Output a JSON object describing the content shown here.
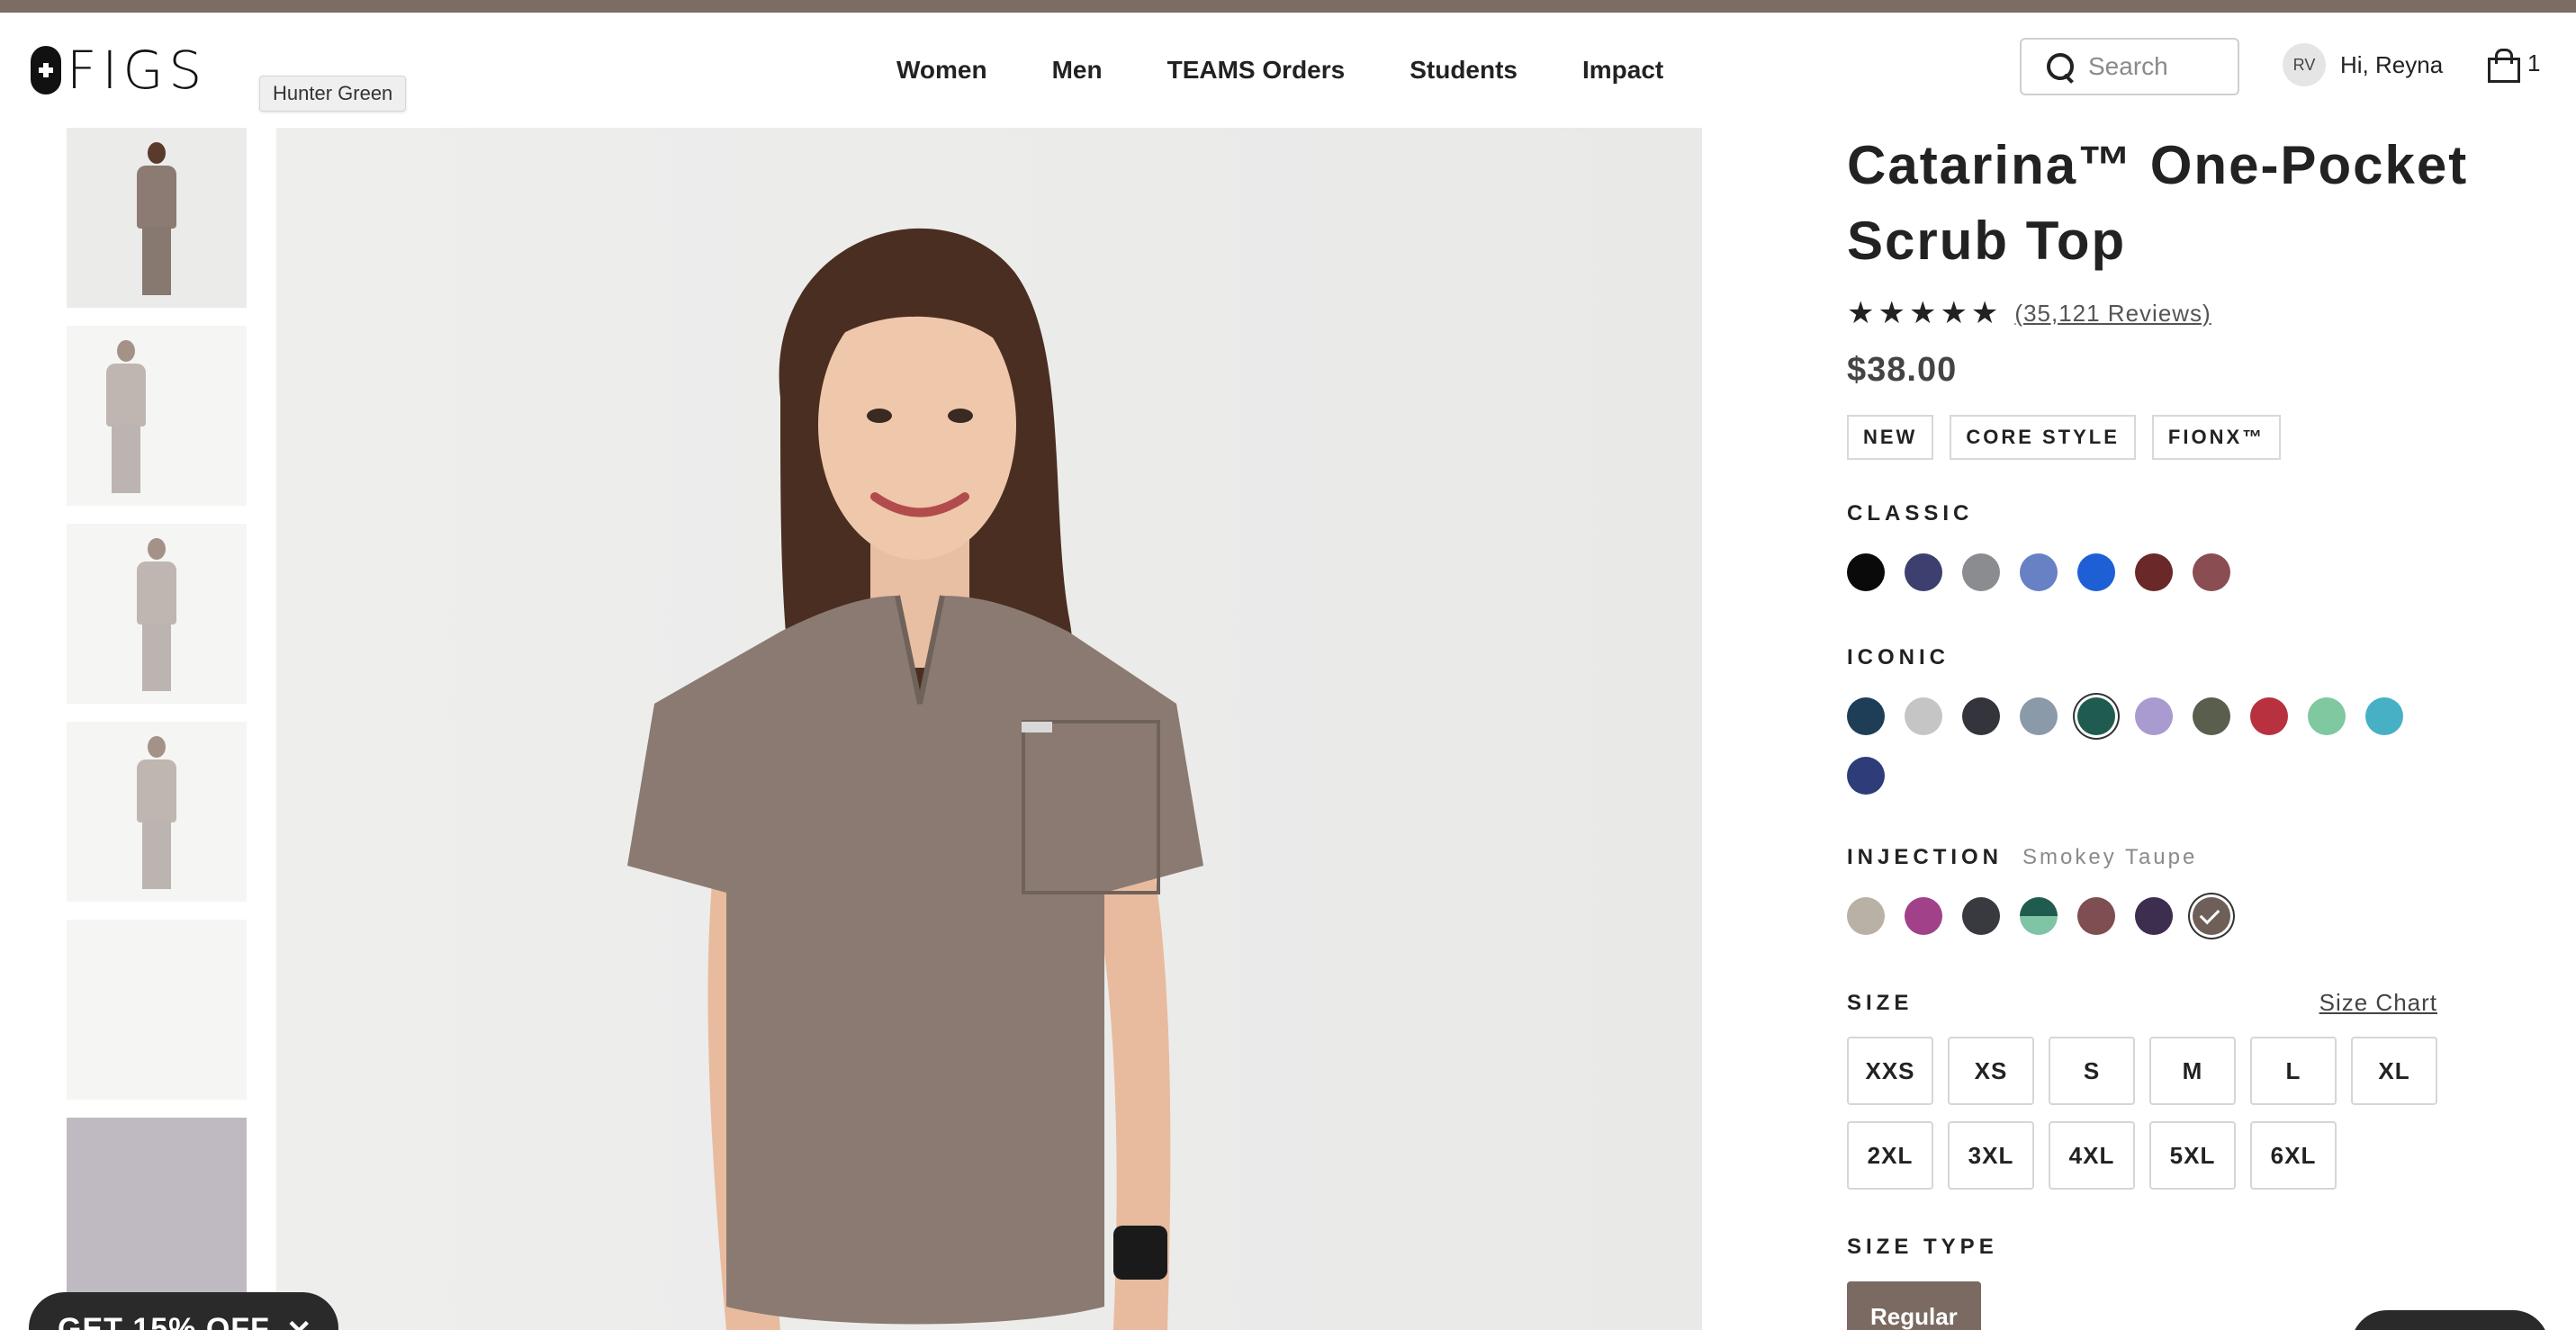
{
  "brand": {
    "logo_text": "FIGS"
  },
  "nav": {
    "items": [
      "Women",
      "Men",
      "TEAMS Orders",
      "Students",
      "Impact"
    ]
  },
  "search": {
    "placeholder": "Search"
  },
  "user": {
    "initials": "RV",
    "greeting": "Hi, Reyna"
  },
  "bag": {
    "count": "1"
  },
  "tooltip": {
    "text": "Hunter Green"
  },
  "product": {
    "title_line1": "Catarina™ One-Pocket",
    "title_line2": "Scrub Top",
    "stars": "★★★★★",
    "reviews": "(35,121 Reviews)",
    "price": "$38.00",
    "rating": 4.8,
    "badges": [
      "NEW",
      "CORE STYLE",
      "FIONX™"
    ]
  },
  "colors": {
    "classic_label": "CLASSIC",
    "classic": [
      "#0a0a0a",
      "#3d3f6e",
      "#8a8c90",
      "#6781c4",
      "#1f5fd6",
      "#6a2828",
      "#8a4e52"
    ],
    "iconic_label": "ICONIC",
    "iconic": [
      "#1e3e58",
      "#c4c5c4",
      "#33343c",
      "#8b9aa8",
      "#1f5c4f",
      "#a99ad0",
      "#5a5e4c",
      "#b8313e",
      "#7fc8a0",
      "#48b0c4",
      "#2e3d7a"
    ],
    "injection_label": "INJECTION",
    "injection_selected_name": "Smokey Taupe",
    "injection": [
      "#b9b1a6",
      "#a1418a",
      "#393a40",
      "split",
      "#7f4e52",
      "#3d2d4e",
      "#6e5f59"
    ],
    "selected_iconic_index": 4,
    "selected_injection_index": 6
  },
  "size": {
    "label": "SIZE",
    "chart_link": "Size Chart",
    "options": [
      "XXS",
      "XS",
      "S",
      "M",
      "L",
      "XL",
      "2XL",
      "3XL",
      "4XL",
      "5XL",
      "6XL"
    ]
  },
  "size_type": {
    "label": "SIZE TYPE",
    "selected": "Regular"
  },
  "promo": {
    "text": "GET 15% OFF",
    "close": "✕"
  }
}
